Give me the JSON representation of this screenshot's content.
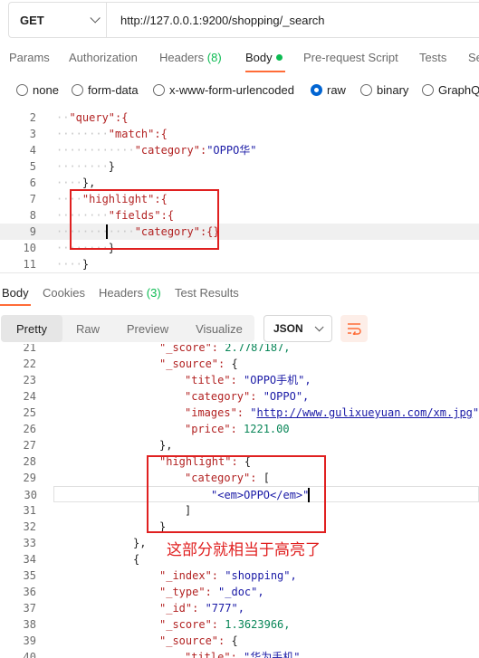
{
  "request": {
    "method": "GET",
    "url": "http://127.0.0.1:9200/shopping/_search"
  },
  "request_tabs": {
    "params": "Params",
    "authorization": "Authorization",
    "headers": "Headers",
    "headers_count": "(8)",
    "body": "Body",
    "prerequest": "Pre-request Script",
    "tests": "Tests",
    "settings": "Se"
  },
  "body_types": {
    "none": "none",
    "form_data": "form-data",
    "urlencoded": "x-www-form-urlencoded",
    "raw": "raw",
    "binary": "binary",
    "graphql": "GraphQL",
    "selected": "raw"
  },
  "request_code": {
    "lines": [
      {
        "n": "2",
        "text": "\"query\":{"
      },
      {
        "n": "3",
        "text": "\"match\":{"
      },
      {
        "n": "4",
        "text": "\"category\":\"OPPO华\""
      },
      {
        "n": "5",
        "text": "}"
      },
      {
        "n": "6",
        "text": "},"
      },
      {
        "n": "7",
        "text": "\"highlight\":{"
      },
      {
        "n": "8",
        "text": "\"fields\":{"
      },
      {
        "n": "9",
        "text": "\"category\":{}"
      },
      {
        "n": "10",
        "text": "}"
      },
      {
        "n": "11",
        "text": "}"
      }
    ]
  },
  "response_tabs": {
    "body": "Body",
    "cookies": "Cookies",
    "headers": "Headers",
    "headers_count": "(3)",
    "test_results": "Test Results"
  },
  "response_toolbar": {
    "pretty": "Pretty",
    "raw": "Raw",
    "preview": "Preview",
    "visualize": "Visualize",
    "format": "JSON"
  },
  "response_code": {
    "lines": [
      {
        "n": "21",
        "text": "\"_score\": 2.7787187,"
      },
      {
        "n": "22",
        "text": "\"_source\": {"
      },
      {
        "n": "23",
        "text": "\"title\": \"OPPO手机\","
      },
      {
        "n": "24",
        "text": "\"category\": \"OPPO\","
      },
      {
        "n": "25",
        "text": "\"images\": \"http://www.gulixueyuan.com/xm.jpg\","
      },
      {
        "n": "26",
        "text": "\"price\": 1221.00"
      },
      {
        "n": "27",
        "text": "},"
      },
      {
        "n": "28",
        "text": "\"highlight\": {"
      },
      {
        "n": "29",
        "text": "\"category\": ["
      },
      {
        "n": "30",
        "text": "\"<em>OPPO</em>\""
      },
      {
        "n": "31",
        "text": "]"
      },
      {
        "n": "32",
        "text": "}"
      },
      {
        "n": "33",
        "text": "},"
      },
      {
        "n": "34",
        "text": "{"
      },
      {
        "n": "35",
        "text": "\"_index\": \"shopping\","
      },
      {
        "n": "36",
        "text": "\"_type\": \"_doc\","
      },
      {
        "n": "37",
        "text": "\"_id\": \"777\","
      },
      {
        "n": "38",
        "text": "\"_score\": 1.3623966,"
      },
      {
        "n": "39",
        "text": "\"_source\": {"
      },
      {
        "n": "40",
        "text": "\"title\": \"华为手机\","
      }
    ]
  },
  "annotation": "这部分就相当于高亮了",
  "colors": {
    "accent": "#ff6c37",
    "radio_selected": "#0265d2",
    "status_green": "#0cbb52",
    "key": "#b22222",
    "string": "#1a1aa6",
    "number": "#098658",
    "annotation_red": "#e02020"
  }
}
